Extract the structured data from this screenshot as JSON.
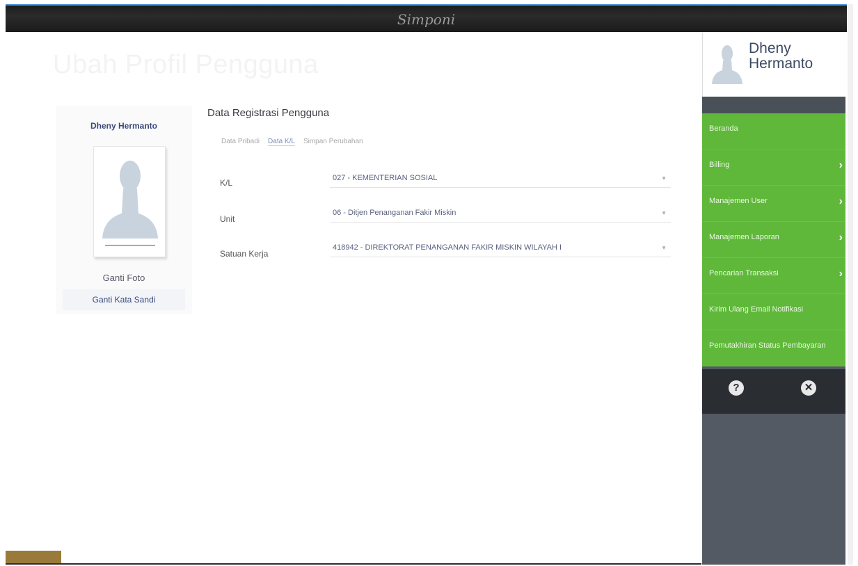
{
  "topbar": {
    "brand": "Simponi"
  },
  "page": {
    "title": "Ubah Profil Pengguna",
    "header_right": ""
  },
  "profile": {
    "name": "Dheny Hermanto",
    "change_photo": "Ganti Foto",
    "change_password": "Ganti Kata Sandi"
  },
  "form": {
    "title": "Data Registrasi Pengguna",
    "tabs": [
      {
        "label": "Data Pribadi",
        "active": false
      },
      {
        "label": "Data K/L",
        "active": true
      },
      {
        "label": "Simpan Perubahan",
        "active": false
      }
    ],
    "rows": [
      {
        "label": "K/L",
        "value": "027 - KEMENTERIAN SOSIAL"
      },
      {
        "label": "Unit",
        "value": "06 - Ditjen Penanganan Fakir Miskin"
      },
      {
        "label": "Satuan Kerja",
        "value": "418942 - DIREKTORAT PENANGANAN FAKIR MISKIN WILAYAH I"
      }
    ]
  },
  "sidebar": {
    "user_name": "Dheny Hermanto",
    "menu": [
      {
        "label": "Beranda",
        "has_arrow": false
      },
      {
        "label": "Billing",
        "has_arrow": true
      },
      {
        "label": "Manajemen User",
        "has_arrow": true
      },
      {
        "label": "Manajemen Laporan",
        "has_arrow": true
      },
      {
        "label": "Pencarian Transaksi",
        "has_arrow": true
      },
      {
        "label": "Kirim Ulang Email Notifikasi",
        "has_arrow": false
      },
      {
        "label": "Pemutakhiran Status Pembayaran",
        "has_arrow": false
      }
    ],
    "help_icon": "?",
    "close_icon": "✕"
  },
  "colors": {
    "menu_green": "#5fb83a",
    "sidebar_dark": "#535a63",
    "topbar": "#1d1d1d"
  }
}
